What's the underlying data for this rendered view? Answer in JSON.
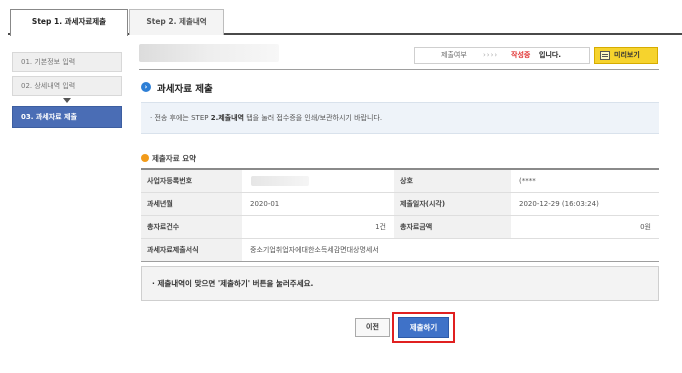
{
  "tabs": [
    {
      "label": "Step 1. 과세자료제출",
      "active": true
    },
    {
      "label": "Step 2. 제출내역",
      "active": false
    }
  ],
  "sidebar": {
    "items": [
      {
        "label": "01. 기본정보 입력"
      },
      {
        "label": "02. 상세내역 입력"
      },
      {
        "label": "03. 과세자료 제출"
      }
    ]
  },
  "status": {
    "label": "제출여부",
    "arrows": "››››",
    "value": "작성중",
    "suffix": "입니다.",
    "preview_label": "미리보기"
  },
  "section": {
    "title": "과세자료 제출",
    "notice_prefix": "· 전송 후에는 STEP ",
    "notice_bold": "2.제출내역",
    "notice_suffix": " 탭을 눌러 접수증을 인쇄/보관하시기 바랍니다."
  },
  "summary": {
    "title": "제출자료 요약",
    "rows": [
      {
        "h1": "사업자등록번호",
        "v1": "",
        "h2": "상호",
        "v2": "(****"
      },
      {
        "h1": "과세년월",
        "v1": "2020-01",
        "h2": "제출일자(시각)",
        "v2": "2020-12-29 (16:03:24)"
      },
      {
        "h1": "총자료건수",
        "v1": "1건",
        "h2": "총자료금액",
        "v2": "0원"
      },
      {
        "h1": "과세자료제출서식",
        "v1": "중소기업취업자에대한소득세감면대상명세서"
      }
    ]
  },
  "bottom_notice": "· 제출내역이 맞으면 '제출하기' 버튼을 눌러주세요.",
  "buttons": {
    "prev": "이전",
    "submit": "제출하기"
  },
  "colors": {
    "accent_blue": "#4a6db5",
    "submit_blue": "#3f72c8",
    "status_red": "#e03030",
    "highlight_frame": "#e02020",
    "preview_yellow": "#f6d32d"
  }
}
